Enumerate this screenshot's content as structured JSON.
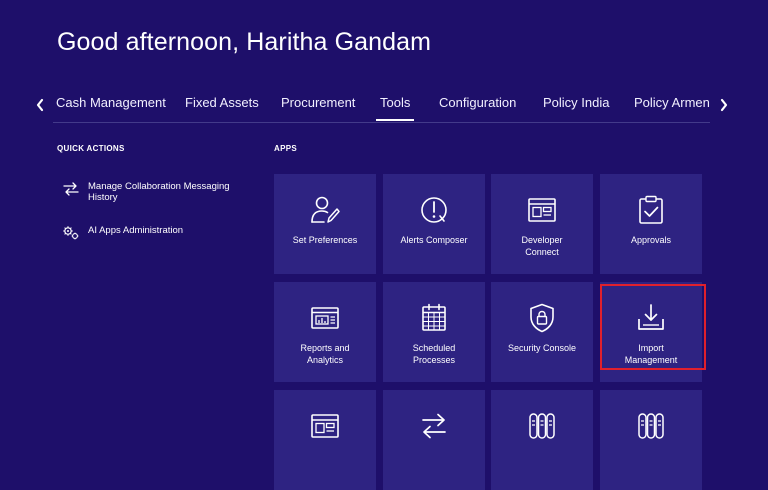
{
  "header": {
    "greeting": "Good afternoon, Haritha Gandam"
  },
  "tabs": [
    {
      "label": "Cash Management",
      "active": false
    },
    {
      "label": "Fixed Assets",
      "active": false
    },
    {
      "label": "Procurement",
      "active": false
    },
    {
      "label": "Tools",
      "active": true
    },
    {
      "label": "Configuration",
      "active": false
    },
    {
      "label": "Policy India",
      "active": false
    },
    {
      "label": "Policy Armenia",
      "active": false
    }
  ],
  "quick_actions": {
    "title": "QUICK ACTIONS",
    "items": [
      {
        "label": "Manage Collaboration Messaging History",
        "icon": "swap-arrows-icon"
      },
      {
        "label": "AI Apps Administration",
        "icon": "gears-icon"
      }
    ]
  },
  "apps": {
    "title": "APPS",
    "tiles": [
      {
        "label": "Set Preferences",
        "icon": "user-edit-icon"
      },
      {
        "label": "Alerts Composer",
        "icon": "alert-clock-icon"
      },
      {
        "label": "Developer\nConnect",
        "icon": "dashboard-window-icon"
      },
      {
        "label": "Approvals",
        "icon": "clipboard-check-icon"
      },
      {
        "label": "Reports and\nAnalytics",
        "icon": "report-chart-icon"
      },
      {
        "label": "Scheduled\nProcesses",
        "icon": "calendar-grid-icon"
      },
      {
        "label": "Security Console",
        "icon": "shield-lock-icon"
      },
      {
        "label": "Import\nManagement",
        "icon": "download-tray-icon"
      },
      {
        "label": "",
        "icon": "dashboard-window-icon"
      },
      {
        "label": "",
        "icon": "swap-arrows-icon"
      },
      {
        "label": "",
        "icon": "server-rack-icon"
      },
      {
        "label": "",
        "icon": "server-rack-icon"
      }
    ]
  },
  "colors": {
    "background": "#1e0f6a",
    "tile": "#2e2382",
    "highlight": "#e0202c"
  }
}
